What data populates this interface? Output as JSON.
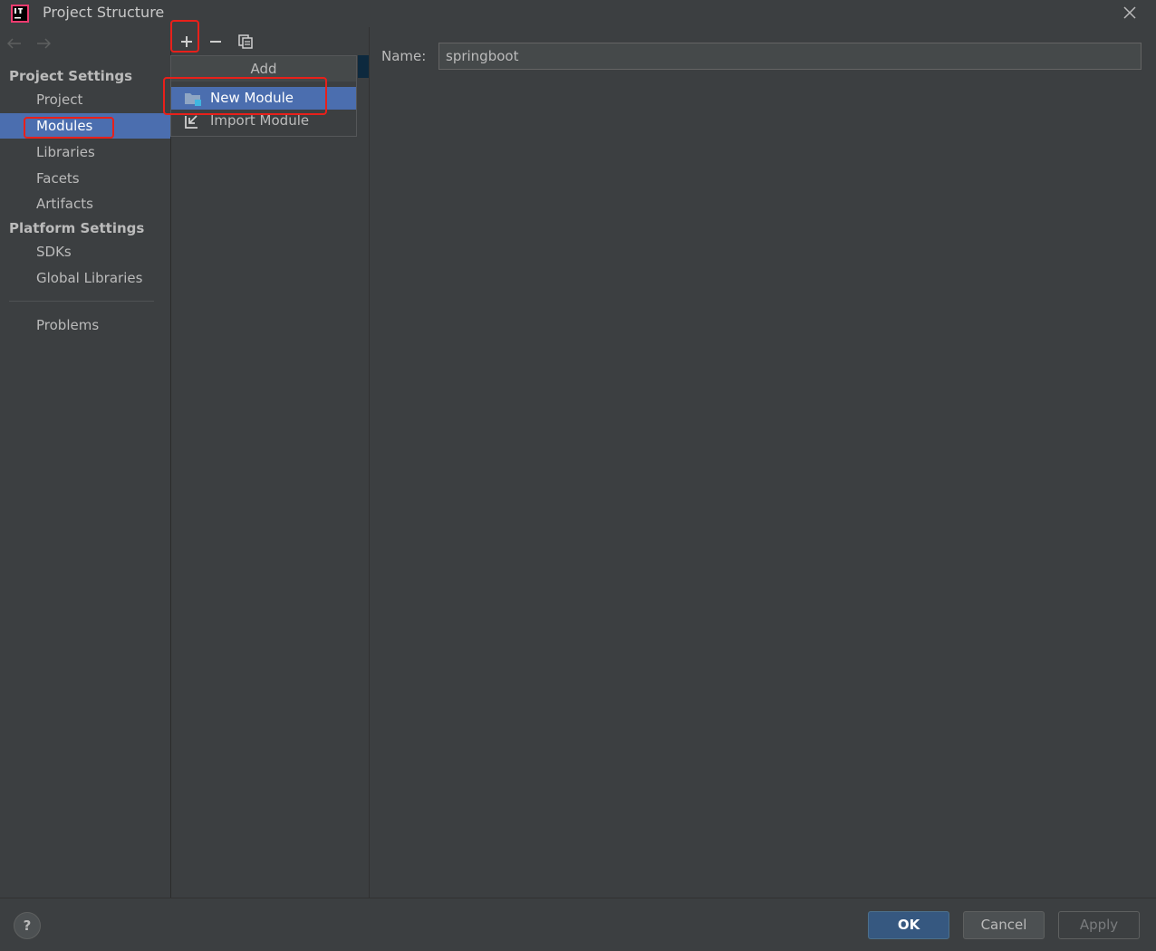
{
  "window": {
    "title": "Project Structure"
  },
  "sidebar": {
    "project_settings_title": "Project Settings",
    "platform_settings_title": "Platform Settings",
    "items": {
      "project": "Project",
      "modules": "Modules",
      "libraries": "Libraries",
      "facets": "Facets",
      "artifacts": "Artifacts",
      "sdks": "SDKs",
      "global_libraries": "Global Libraries",
      "problems": "Problems"
    },
    "selected": "Modules"
  },
  "toolbar": {
    "add_icon": "plus-icon",
    "remove_icon": "minus-icon",
    "copy_icon": "copy-icon"
  },
  "add_menu": {
    "header": "Add",
    "items": [
      "New Module",
      "Import Module"
    ],
    "selected": "New Module"
  },
  "module": {
    "name_label": "Name:",
    "name_value": "springboot"
  },
  "buttons": {
    "help": "?",
    "ok": "OK",
    "cancel": "Cancel",
    "apply": "Apply"
  },
  "colors": {
    "background": "#3c3f41",
    "selection": "#4b6eaf",
    "ok_button": "#365880",
    "annotation": "#e8201a"
  }
}
